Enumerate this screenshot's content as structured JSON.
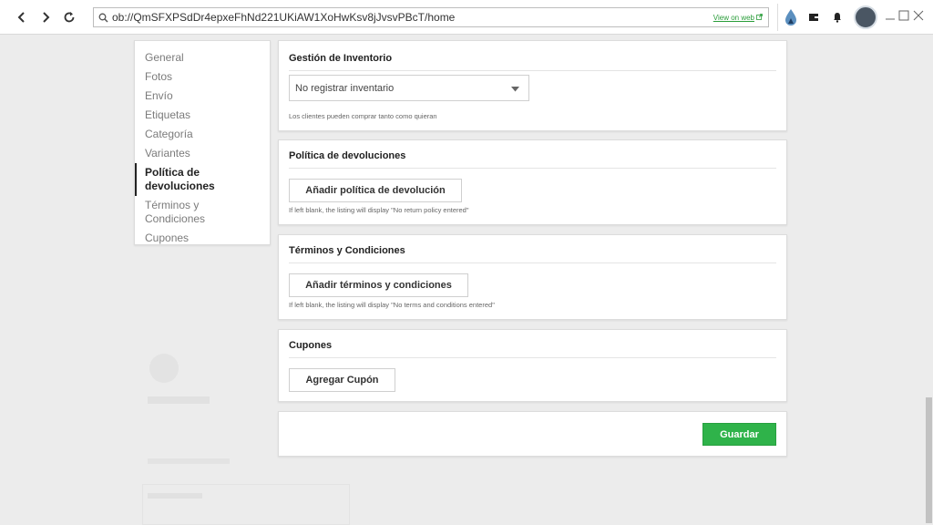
{
  "browser": {
    "url": "ob://QmSFXPSdDr4epxeFhNd221UKiAW1XoHwKsv8jJvsvPBcT/home",
    "view_on_web": "View on web",
    "icons": [
      "back-icon",
      "forward-icon",
      "reload-icon",
      "search-icon",
      "external-link-icon",
      "droplet-icon",
      "wallet-icon",
      "bell-icon",
      "minimize-icon",
      "maximize-icon",
      "close-icon"
    ]
  },
  "sidebar": {
    "items": [
      {
        "label": "General"
      },
      {
        "label": "Fotos"
      },
      {
        "label": "Envío"
      },
      {
        "label": "Etiquetas"
      },
      {
        "label": "Categoría"
      },
      {
        "label": "Variantes"
      },
      {
        "label": "Política de devoluciones"
      },
      {
        "label": "Términos y Condiciones"
      },
      {
        "label": "Cupones"
      }
    ],
    "active_index": 6
  },
  "inventory": {
    "title": "Gestión de Inventorio",
    "select_value": "No registrar inventario",
    "hint": "Los clientes pueden comprar tanto como quieran"
  },
  "returns": {
    "title": "Política de devoluciones",
    "button": "Añadir política de devolución",
    "hint": "If left blank, the listing will display \"No return policy entered\""
  },
  "terms": {
    "title": "Términos y Condiciones",
    "button": "Añadir términos y condiciones",
    "hint": "If left blank, the listing will display \"No terms and conditions entered\""
  },
  "coupons": {
    "title": "Cupones",
    "button": "Agregar Cupón"
  },
  "footer": {
    "save": "Guardar"
  },
  "colors": {
    "accent": "#2fb34a",
    "link": "#2a9d3a",
    "background": "#ececec"
  }
}
